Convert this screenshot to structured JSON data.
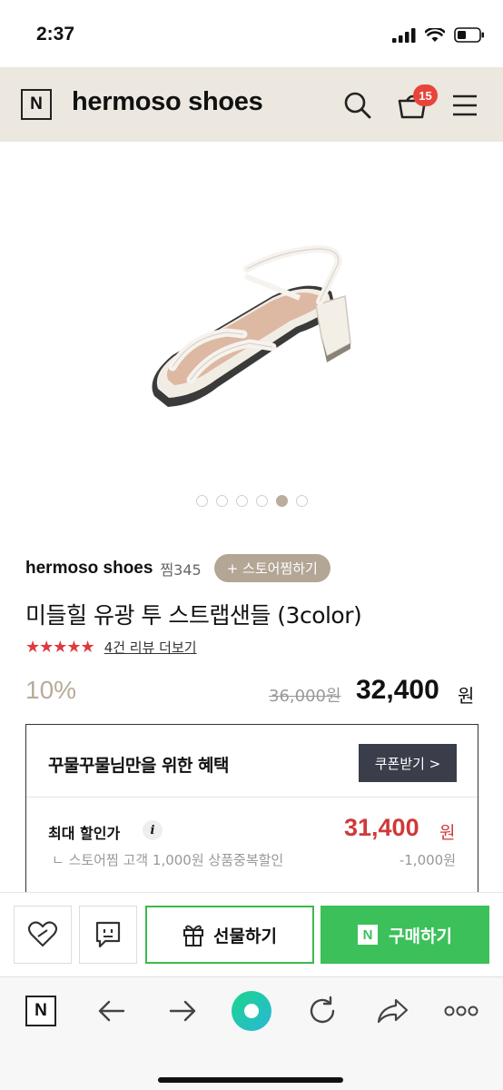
{
  "status_bar": {
    "time": "2:37"
  },
  "header": {
    "logo": "N",
    "store_name": "hermoso shoes",
    "cart_count": "15"
  },
  "image_dots": {
    "total": 6,
    "active_index": 4
  },
  "seller": {
    "name": "hermoso shoes",
    "fav_count": "찜345",
    "store_fav_button": "+ 스토어찜하기"
  },
  "product": {
    "title": "미들힐 유광 투 스트랩샌들 (3color)",
    "stars": "★★★★★",
    "rating": 5,
    "review_link": "4건 리뷰 더보기",
    "discount": "10%",
    "original_price": "36,000원",
    "sale_price": "32,400",
    "sale_unit": "원"
  },
  "benefit": {
    "title": "꾸물꾸물님만을 위한 혜택",
    "coupon_button": "쿠폰받기 >",
    "max_label": "최대 할인가",
    "info": "i",
    "max_price": "31,400",
    "max_unit": "원",
    "sub_label": "ㄴ 스토어찜 고객 1,000원 상품중복할인",
    "sub_value": "-1,000원"
  },
  "actions": {
    "gift_label": "선물하기",
    "buy_label": "구매하기",
    "buy_logo": "N"
  },
  "browser": {
    "logo": "N",
    "more": "ooo"
  },
  "colors": {
    "header_bg": "#ece7df",
    "accent_green": "#3cc05a",
    "price_red": "#d0393a",
    "badge_red": "#e8443a",
    "tag_beige": "#b3a695"
  }
}
